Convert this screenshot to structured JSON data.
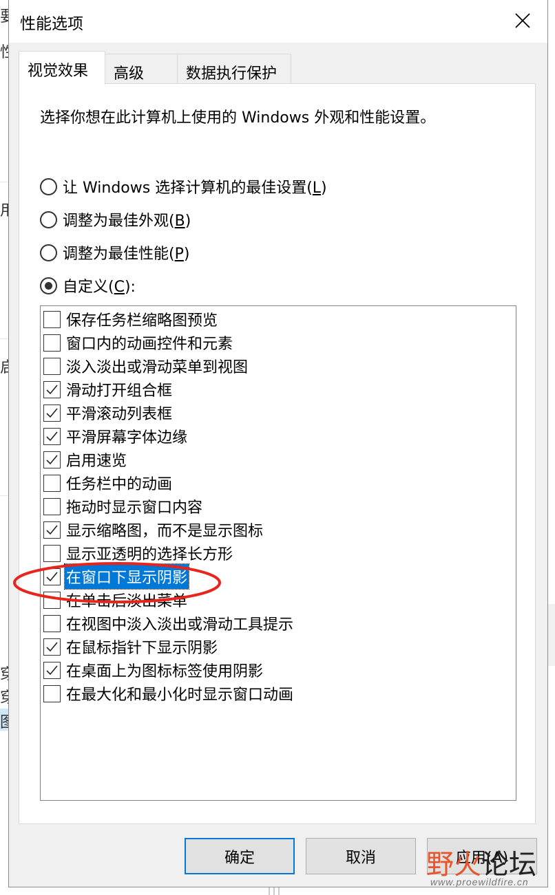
{
  "background_fragments": [
    "要",
    "性",
    "用",
    "启",
    "穿",
    "穿",
    "图"
  ],
  "dialog": {
    "title": "性能选项",
    "close_icon": "close-icon"
  },
  "tabs": [
    {
      "label": "视觉效果",
      "active": true
    },
    {
      "label": "高级",
      "active": false
    },
    {
      "label": "数据执行保护",
      "active": false
    }
  ],
  "description": "选择你想在此计算机上使用的 Windows 外观和性能设置。",
  "radios": [
    {
      "text": "让 Windows 选择计算机的最佳设置(",
      "key": "L",
      "end": ")",
      "checked": false
    },
    {
      "text": "调整为最佳外观(",
      "key": "B",
      "end": ")",
      "checked": false
    },
    {
      "text": "调整为最佳性能(",
      "key": "P",
      "end": ")",
      "checked": false
    },
    {
      "text": "自定义(",
      "key": "C",
      "end": "):",
      "checked": true
    }
  ],
  "options": [
    {
      "label": "保存任务栏缩略图预览",
      "checked": false
    },
    {
      "label": "窗口内的动画控件和元素",
      "checked": false
    },
    {
      "label": "淡入淡出或滑动菜单到视图",
      "checked": false
    },
    {
      "label": "滑动打开组合框",
      "checked": true
    },
    {
      "label": "平滑滚动列表框",
      "checked": true
    },
    {
      "label": "平滑屏幕字体边缘",
      "checked": true
    },
    {
      "label": "启用速览",
      "checked": true
    },
    {
      "label": "任务栏中的动画",
      "checked": false
    },
    {
      "label": "拖动时显示窗口内容",
      "checked": false
    },
    {
      "label": "显示缩略图，而不是显示图标",
      "checked": true
    },
    {
      "label": "显示亚透明的选择长方形",
      "checked": false
    },
    {
      "label": "在窗口下显示阴影",
      "checked": true,
      "selected": true
    },
    {
      "label": "在单击后淡出菜单",
      "checked": false
    },
    {
      "label": "在视图中淡入淡出或滑动工具提示",
      "checked": false
    },
    {
      "label": "在鼠标指针下显示阴影",
      "checked": true
    },
    {
      "label": "在桌面上为图标标签使用阴影",
      "checked": true
    },
    {
      "label": "在最大化和最小化时显示窗口动画",
      "checked": false
    }
  ],
  "buttons": {
    "ok": "确定",
    "cancel": "取消",
    "apply": "应用(A)"
  },
  "watermark": {
    "text_a": "野火",
    "text_b": "论坛",
    "url": "www.proewildfire.cn"
  },
  "colors": {
    "selection": "#0078d7",
    "annotation": "#e8241c",
    "dialog_bg": "#f0f0f0"
  }
}
